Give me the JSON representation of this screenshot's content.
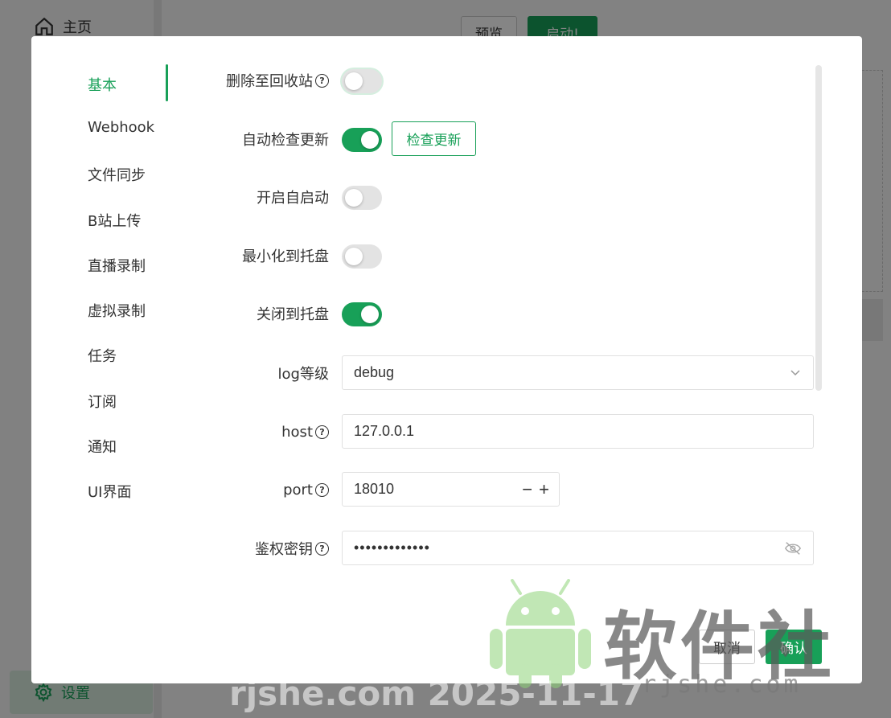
{
  "background": {
    "home_label": "主页",
    "settings_label": "设置",
    "preview_label": "预览",
    "start_label": "启动!"
  },
  "nav": {
    "items": [
      {
        "label": "基本",
        "active": true
      },
      {
        "label": "Webhook"
      },
      {
        "label": "文件同步"
      },
      {
        "label": "B站上传"
      },
      {
        "label": "直播录制"
      },
      {
        "label": "虚拟录制"
      },
      {
        "label": "任务"
      },
      {
        "label": "订阅"
      },
      {
        "label": "通知"
      },
      {
        "label": "UI界面"
      }
    ]
  },
  "form": {
    "delete_to_trash": {
      "label": "删除至回收站",
      "value": false
    },
    "auto_check_update": {
      "label": "自动检查更新",
      "value": true,
      "button_label": "检查更新"
    },
    "autostart": {
      "label": "开启自启动",
      "value": false
    },
    "minimize_to_tray": {
      "label": "最小化到托盘",
      "value": false
    },
    "close_to_tray": {
      "label": "关闭到托盘",
      "value": true
    },
    "log_level": {
      "label": "log等级",
      "value": "debug"
    },
    "host": {
      "label": "host",
      "value": "127.0.0.1"
    },
    "port": {
      "label": "port",
      "value": "18010"
    },
    "auth_key": {
      "label": "鉴权密钥",
      "value": "•••••••••••••"
    }
  },
  "footer": {
    "cancel_label": "取消",
    "confirm_label": "确认"
  },
  "watermark": {
    "logo_text": "软件社",
    "site_text": "rjshe.com",
    "date_text": "rjshe.com 2025-11-17"
  },
  "colors": {
    "accent": "#18a058",
    "switch_off": "#e3e3e3",
    "text": "#333333"
  },
  "icons": {
    "home": "home-icon",
    "settings": "gear-icon",
    "help": "help-circle-icon",
    "select_arrow": "chevron-down-icon",
    "eye_off": "eye-off-icon"
  }
}
